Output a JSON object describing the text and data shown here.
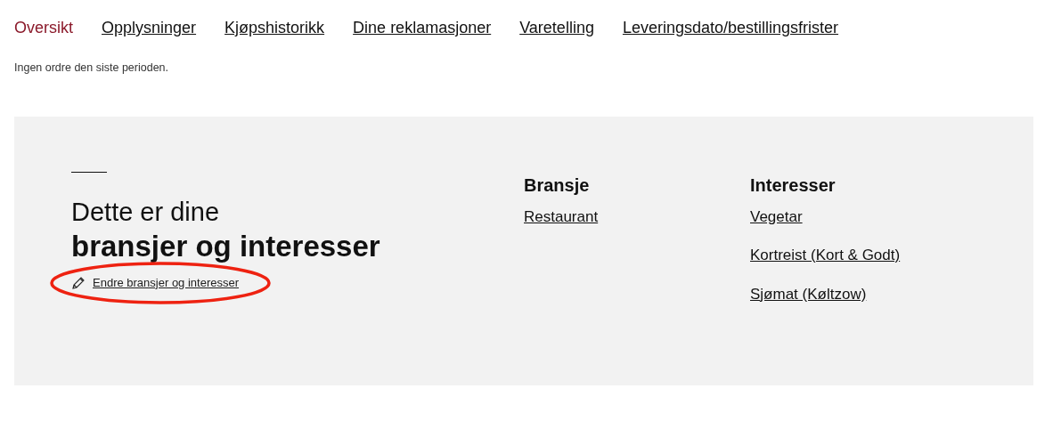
{
  "tabs": [
    {
      "label": "Oversikt",
      "selected": true
    },
    {
      "label": "Opplysninger",
      "selected": false
    },
    {
      "label": "Kjøpshistorikk",
      "selected": false
    },
    {
      "label": "Dine reklamasjoner",
      "selected": false
    },
    {
      "label": "Varetelling",
      "selected": false
    },
    {
      "label": "Leveringsdato/bestillingsfrister",
      "selected": false
    }
  ],
  "message": "Ingen ordre den siste perioden.",
  "profile": {
    "heading_light": "Dette er dine",
    "heading_bold": "bransjer og interesser",
    "edit_link": {
      "label": "Endre bransjer og interesser",
      "circled": true
    },
    "groups": [
      {
        "title": "Bransje",
        "items": [
          "Restaurant"
        ]
      },
      {
        "title": "Interesser",
        "items": [
          "Vegetar",
          "Kortreist (Kort & Godt)",
          "Sjømat (Køltzow)"
        ]
      }
    ]
  }
}
